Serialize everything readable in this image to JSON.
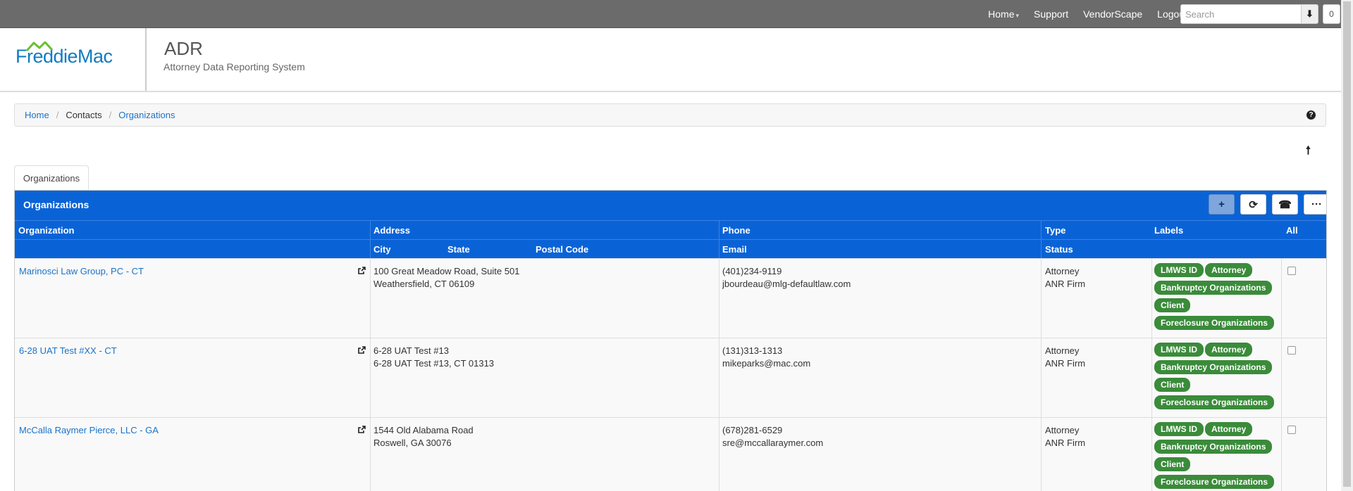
{
  "topnav": {
    "links": [
      "Home",
      "Support",
      "VendorScape",
      "Logout"
    ],
    "search_placeholder": "Search",
    "count": "0"
  },
  "header": {
    "logo_word1": "Freddie",
    "logo_word2": "Mac",
    "title": "ADR",
    "subtitle": "Attorney Data Reporting System"
  },
  "breadcrumb": {
    "items": [
      "Home",
      "Contacts",
      "Organizations"
    ]
  },
  "tabs": [
    "Organizations"
  ],
  "panel": {
    "title": "Organizations",
    "columns_row1": [
      "Organization",
      "Address",
      "Phone",
      "Type",
      "Labels",
      "All"
    ],
    "columns_row2": [
      "City",
      "State",
      "Postal Code",
      "Email",
      "Status"
    ]
  },
  "rows": [
    {
      "org": "Marinosci Law Group, PC - CT",
      "address1": "100 Great Meadow Road, Suite 501",
      "address2": "Weathersfield, CT 06109",
      "phone": "(401)234-9119",
      "email": "jbourdeau@mlg-defaultlaw.com",
      "type": "Attorney",
      "status": "ANR Firm",
      "labels": [
        "LMWS ID",
        "Attorney",
        "Bankruptcy Organizations",
        "Client",
        "Foreclosure Organizations"
      ]
    },
    {
      "org": "6-28 UAT Test #XX - CT",
      "address1": "6-28 UAT Test #13",
      "address2": "6-28 UAT Test #13, CT 01313",
      "phone": "(131)313-1313",
      "email": "mikeparks@mac.com",
      "type": "Attorney",
      "status": "ANR Firm",
      "labels": [
        "LMWS ID",
        "Attorney",
        "Bankruptcy Organizations",
        "Client",
        "Foreclosure Organizations"
      ]
    },
    {
      "org": "McCalla Raymer Pierce, LLC - GA",
      "address1": "1544 Old Alabama Road",
      "address2": "Roswell, GA 30076",
      "phone": "(678)281-6529",
      "email": "sre@mccallaraymer.com",
      "type": "Attorney",
      "status": "ANR Firm",
      "labels": [
        "LMWS ID",
        "Attorney",
        "Bankruptcy Organizations",
        "Client",
        "Foreclosure Organizations"
      ]
    }
  ]
}
